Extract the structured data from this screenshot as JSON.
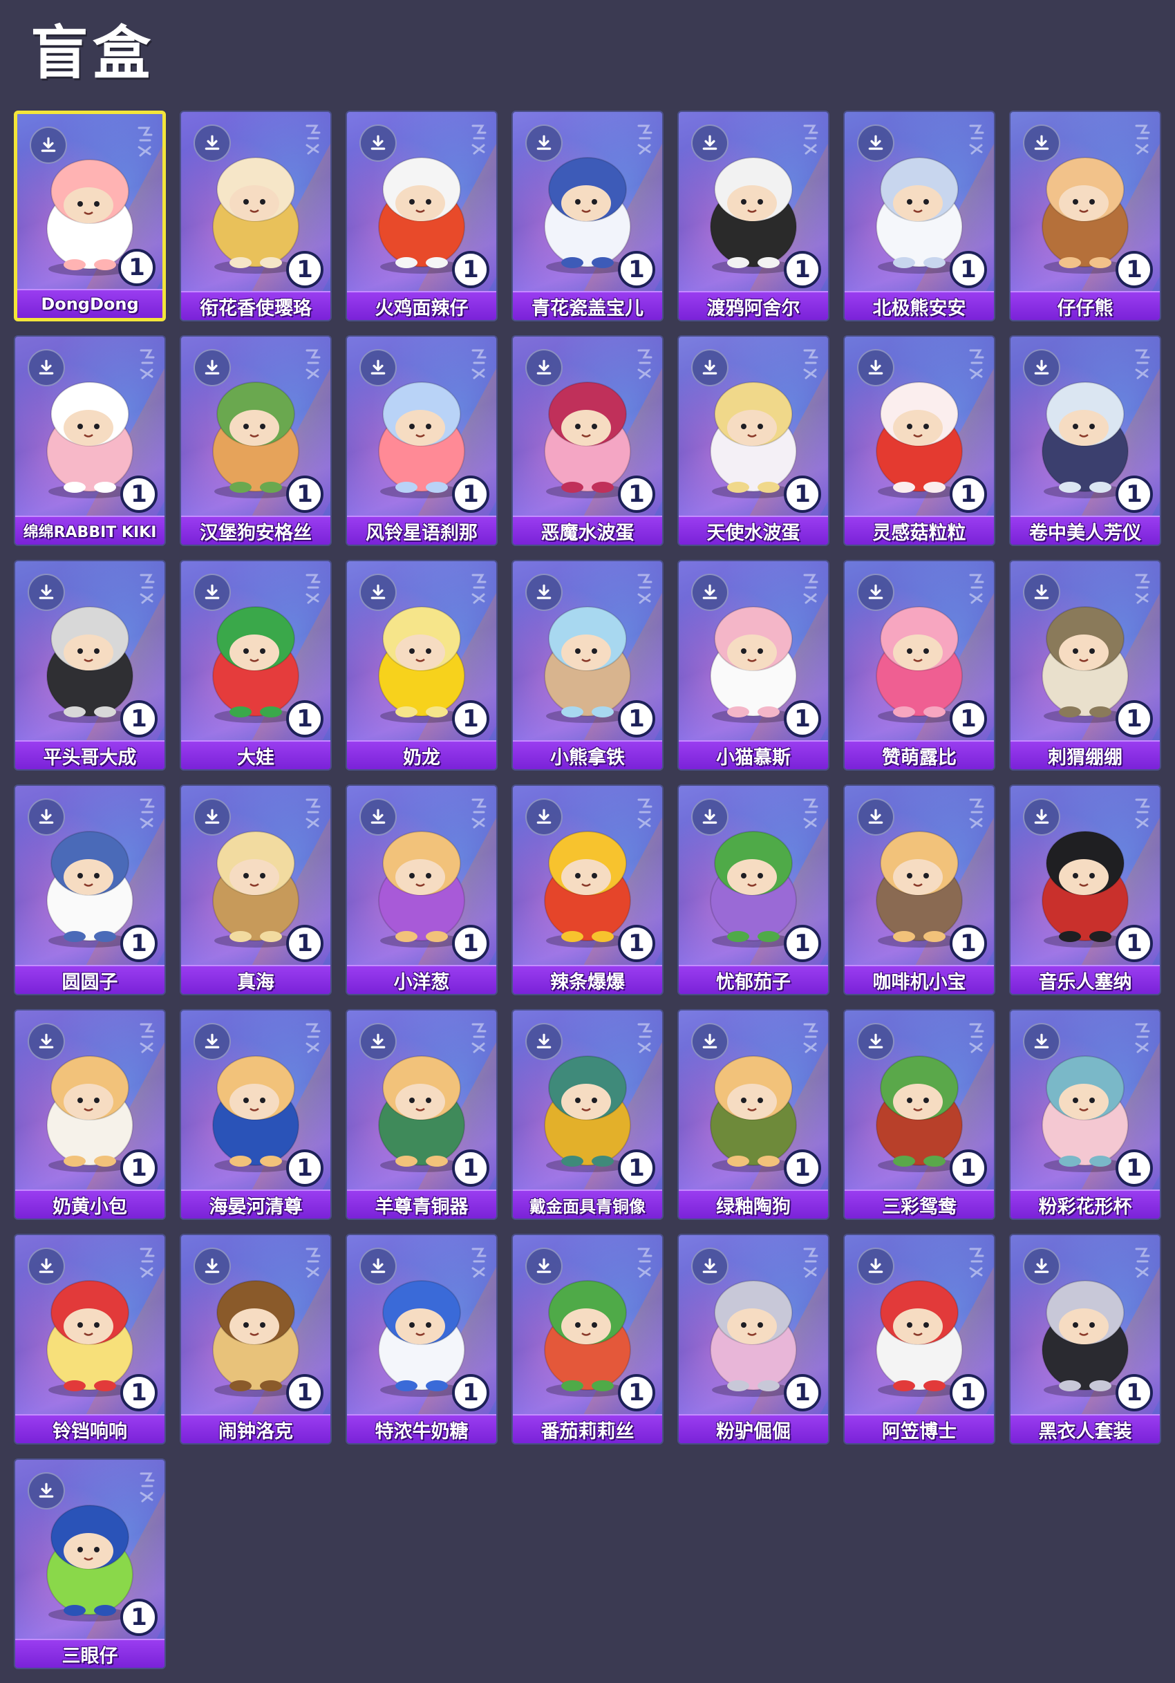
{
  "page": {
    "title": "盲盒"
  },
  "colors": {
    "background": "#3b3a52",
    "selected_border": "#f3e53a",
    "name_bar": "#8a2fe6",
    "badge_text": "#1d2158"
  },
  "cards": [
    {
      "name": "DongDong",
      "count": "1",
      "selected": true,
      "figure": "white-sheep",
      "c1": "#ffffff",
      "c2": "#ffb3b3",
      "bg": "#6f7ce0"
    },
    {
      "name": "衔花香使璎珞",
      "count": "1",
      "figure": "golden-lady",
      "c1": "#e9c15a",
      "c2": "#f6e6c8",
      "bg": "#7a6fe0"
    },
    {
      "name": "火鸡面辣仔",
      "count": "1",
      "figure": "noodle-bowl",
      "c1": "#e84a2a",
      "c2": "#f5f5f5",
      "bg": "#7c78e4"
    },
    {
      "name": "青花瓷盖宝儿",
      "count": "1",
      "figure": "porcelain-pot",
      "c1": "#f2f4fb",
      "c2": "#3d5bb8",
      "bg": "#7f7ce4"
    },
    {
      "name": "渡鸦阿舍尔",
      "count": "1",
      "figure": "plague-doctor",
      "c1": "#2a2a2a",
      "c2": "#f2f2f2",
      "bg": "#7a77e0"
    },
    {
      "name": "北极熊安安",
      "count": "1",
      "figure": "polar-bear",
      "c1": "#f5f7fb",
      "c2": "#c8d6ee",
      "bg": "#6e79dc"
    },
    {
      "name": "仔仔熊",
      "count": "1",
      "figure": "brown-bear",
      "c1": "#b5703a",
      "c2": "#f2c28a",
      "bg": "#7480de"
    },
    {
      "name": "绵绵RABBIT KIKI",
      "count": "1",
      "figure": "pink-rabbit",
      "c1": "#f7b8c8",
      "c2": "#ffffff",
      "bg": "#7e6fd8"
    },
    {
      "name": "汉堡狗安格丝",
      "count": "1",
      "figure": "burger-dog",
      "c1": "#e6a35a",
      "c2": "#6aa84f",
      "bg": "#7d74de"
    },
    {
      "name": "风铃星语刹那",
      "count": "1",
      "figure": "wind-chime",
      "c1": "#ff8a96",
      "c2": "#b9d3f7",
      "bg": "#7a78e0"
    },
    {
      "name": "恶魔水波蛋",
      "count": "1",
      "figure": "devil-egg",
      "c1": "#f4a6c4",
      "c2": "#c0305a",
      "bg": "#8070da"
    },
    {
      "name": "天使水波蛋",
      "count": "1",
      "figure": "angel-egg",
      "c1": "#f4f0f6",
      "c2": "#f0d88a",
      "bg": "#7c7fe0"
    },
    {
      "name": "灵感菇粒粒",
      "count": "1",
      "figure": "mushroom",
      "c1": "#e43a30",
      "c2": "#fbeeee",
      "bg": "#6f79dc"
    },
    {
      "name": "卷中美人芳仪",
      "count": "1",
      "figure": "scroll-lady",
      "c1": "#3b3f6e",
      "c2": "#dbe6f2",
      "bg": "#7074d8"
    },
    {
      "name": "平头哥大成",
      "count": "1",
      "figure": "honey-badger",
      "c1": "#2f2f33",
      "c2": "#d8d8d8",
      "bg": "#6f78da"
    },
    {
      "name": "大娃",
      "count": "1",
      "figure": "calabash-kid",
      "c1": "#e53c3c",
      "c2": "#3aa84a",
      "bg": "#7878e0"
    },
    {
      "name": "奶龙",
      "count": "1",
      "figure": "milk-dragon",
      "c1": "#f7d21c",
      "c2": "#f6e58a",
      "bg": "#7a7ee2"
    },
    {
      "name": "小熊拿铁",
      "count": "1",
      "figure": "latte-bear",
      "c1": "#d8b48e",
      "c2": "#a8d8f0",
      "bg": "#7a77e0"
    },
    {
      "name": "小猫慕斯",
      "count": "1",
      "figure": "mousse-cat",
      "c1": "#fafafa",
      "c2": "#f4b6c8",
      "bg": "#7b76e0"
    },
    {
      "name": "赞萌露比",
      "count": "1",
      "figure": "pink-beaver",
      "c1": "#ef5f92",
      "c2": "#f7a6c0",
      "bg": "#6e7adc"
    },
    {
      "name": "刺猬绷绷",
      "count": "1",
      "figure": "mummy-hedgehog",
      "c1": "#e9e0cc",
      "c2": "#8a7a5a",
      "bg": "#7476da"
    },
    {
      "name": "圆圆子",
      "count": "1",
      "figure": "seal",
      "c1": "#fafafa",
      "c2": "#4a6ab8",
      "bg": "#7f70dc"
    },
    {
      "name": "真海",
      "count": "1",
      "figure": "qing-official",
      "c1": "#c79a5a",
      "c2": "#f2dba0",
      "bg": "#7478de"
    },
    {
      "name": "小洋葱",
      "count": "1",
      "figure": "onion",
      "c1": "#a85ad8",
      "c2": "#f2c27a",
      "bg": "#7a7ae2"
    },
    {
      "name": "辣条爆爆",
      "count": "1",
      "figure": "spicy-strip",
      "c1": "#e5452a",
      "c2": "#f7c32e",
      "bg": "#7878e0"
    },
    {
      "name": "忧郁茄子",
      "count": "1",
      "figure": "eggplant",
      "c1": "#9a6ad6",
      "c2": "#4faa48",
      "bg": "#7b7ce2"
    },
    {
      "name": "咖啡机小宝",
      "count": "1",
      "figure": "coffee-machine",
      "c1": "#8a6a52",
      "c2": "#f2c27a",
      "bg": "#7179dc"
    },
    {
      "name": "音乐人塞纳",
      "count": "1",
      "figure": "musician",
      "c1": "#c9302c",
      "c2": "#1f1f22",
      "bg": "#7378dc"
    },
    {
      "name": "奶黄小包",
      "count": "1",
      "figure": "custard-bun",
      "c1": "#f6f2ea",
      "c2": "#f2c27a",
      "bg": "#7f72dc"
    },
    {
      "name": "海晏河清尊",
      "count": "1",
      "figure": "blue-vase",
      "c1": "#2a53b8",
      "c2": "#f2c27a",
      "bg": "#7376de"
    },
    {
      "name": "羊尊青铜器",
      "count": "1",
      "figure": "bronze-ram",
      "c1": "#3f8a5a",
      "c2": "#f2c27a",
      "bg": "#7a7ae2"
    },
    {
      "name": "戴金面具青铜像",
      "count": "1",
      "figure": "gold-mask",
      "c1": "#e3b02a",
      "c2": "#3f8a7a",
      "bg": "#7878e0"
    },
    {
      "name": "绿釉陶狗",
      "count": "1",
      "figure": "green-dog",
      "c1": "#6e8a3a",
      "c2": "#f2c27a",
      "bg": "#7b7ce2"
    },
    {
      "name": "三彩鸳鸯",
      "count": "1",
      "figure": "sancai-duck",
      "c1": "#b8402a",
      "c2": "#5aa84a",
      "bg": "#7179dc"
    },
    {
      "name": "粉彩花形杯",
      "count": "1",
      "figure": "flower-cup",
      "c1": "#f4c8d2",
      "c2": "#7ab8c8",
      "bg": "#7378dc"
    },
    {
      "name": "铃铛响响",
      "count": "1",
      "figure": "bell-girl",
      "c1": "#f7e07a",
      "c2": "#e23a3a",
      "bg": "#7f72dc"
    },
    {
      "name": "闹钟洛克",
      "count": "1",
      "figure": "alarm-clock",
      "c1": "#e8c27a",
      "c2": "#8a5a2a",
      "bg": "#7376de"
    },
    {
      "name": "特浓牛奶糖",
      "count": "1",
      "figure": "milk-candy",
      "c1": "#f4f6fb",
      "c2": "#3a6ad8",
      "bg": "#7a7ae2"
    },
    {
      "name": "番茄莉莉丝",
      "count": "1",
      "figure": "tomato",
      "c1": "#e4583a",
      "c2": "#4faa48",
      "bg": "#7878e0"
    },
    {
      "name": "粉驴倔倔",
      "count": "1",
      "figure": "pink-donkey",
      "c1": "#e8b6d8",
      "c2": "#c8c8d8",
      "bg": "#7b7ce2"
    },
    {
      "name": "阿笠博士",
      "count": "1",
      "figure": "professor",
      "c1": "#f4f4f4",
      "c2": "#e23a3a",
      "bg": "#7179dc"
    },
    {
      "name": "黑衣人套装",
      "count": "1",
      "figure": "black-suit",
      "c1": "#2a2a30",
      "c2": "#c8c8d8",
      "bg": "#7378dc"
    },
    {
      "name": "三眼仔",
      "count": "1",
      "figure": "alien",
      "c1": "#8ad84a",
      "c2": "#2a53b8",
      "bg": "#7f72dc"
    }
  ]
}
